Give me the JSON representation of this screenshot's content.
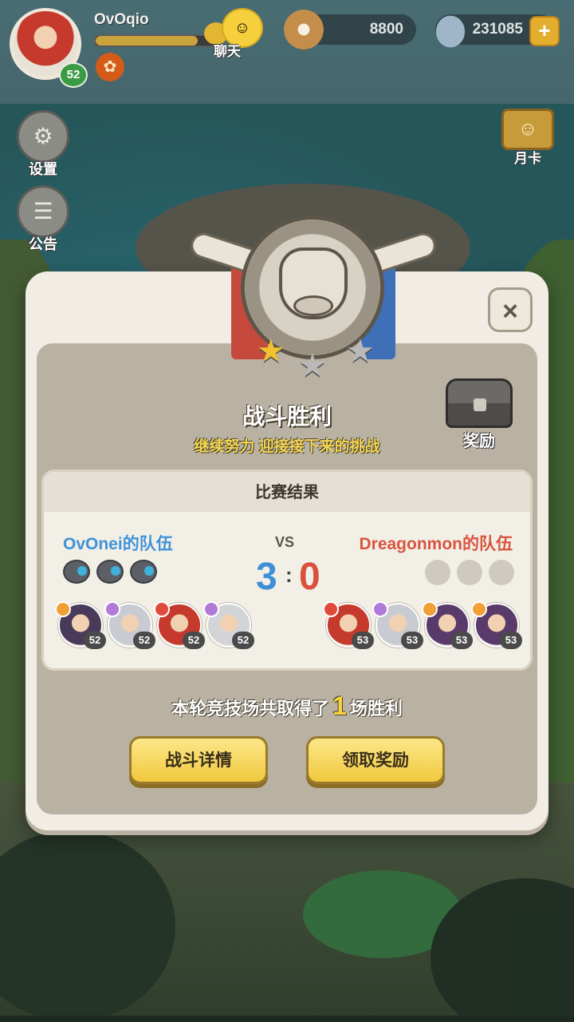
{
  "hud": {
    "player_name": "OvOqio",
    "player_level": "52",
    "xp_progress_percent": 85,
    "chat_label": "聊天",
    "currency_1": "8800",
    "currency_2": "231085",
    "plus_symbol": "+",
    "settings_label": "设置",
    "notice_label": "公告",
    "month_card_label": "月卡"
  },
  "dialog": {
    "close_symbol": "×",
    "title": "战斗胜利",
    "subtitle": "继续努力 迎接接下来的挑战",
    "reward_label": "奖励",
    "stars_earned": 1,
    "stars_total": 3,
    "result": {
      "header": "比赛结果",
      "vs": "VS",
      "left_team": "OvOnei的队伍",
      "right_team": "Dreagonmon的队伍",
      "left_score": "3",
      "separator": ":",
      "right_score": "0",
      "left_wins": 3,
      "right_wins": 0,
      "left_heroes": [
        {
          "level": "52",
          "element_color": "#f0a035",
          "skin": "#4a3a5a"
        },
        {
          "level": "52",
          "element_color": "#b07ad8",
          "skin": "#c8ccd2"
        },
        {
          "level": "52",
          "element_color": "#e04a3a",
          "skin": "#c53a2c"
        },
        {
          "level": "52",
          "element_color": "#b07ad8",
          "skin": "#d2d4d8"
        }
      ],
      "right_heroes": [
        {
          "level": "53",
          "element_color": "#e04a3a",
          "skin": "#c53a2c"
        },
        {
          "level": "53",
          "element_color": "#b07ad8",
          "skin": "#c8ccd2"
        },
        {
          "level": "53",
          "element_color": "#f0a035",
          "skin": "#5a3a6a"
        },
        {
          "level": "53",
          "element_color": "#f0a035",
          "skin": "#5a3a6a"
        }
      ]
    },
    "summary_prefix": "本轮竞技场共取得了",
    "summary_count": "1",
    "summary_suffix": "场胜利",
    "button_details": "战斗详情",
    "button_claim": "领取奖励"
  },
  "colors": {
    "left_team": "#3f93d9",
    "right_team": "#d9543f",
    "gold_text": "#f4d652",
    "button_yellow": "#f2c93e"
  }
}
